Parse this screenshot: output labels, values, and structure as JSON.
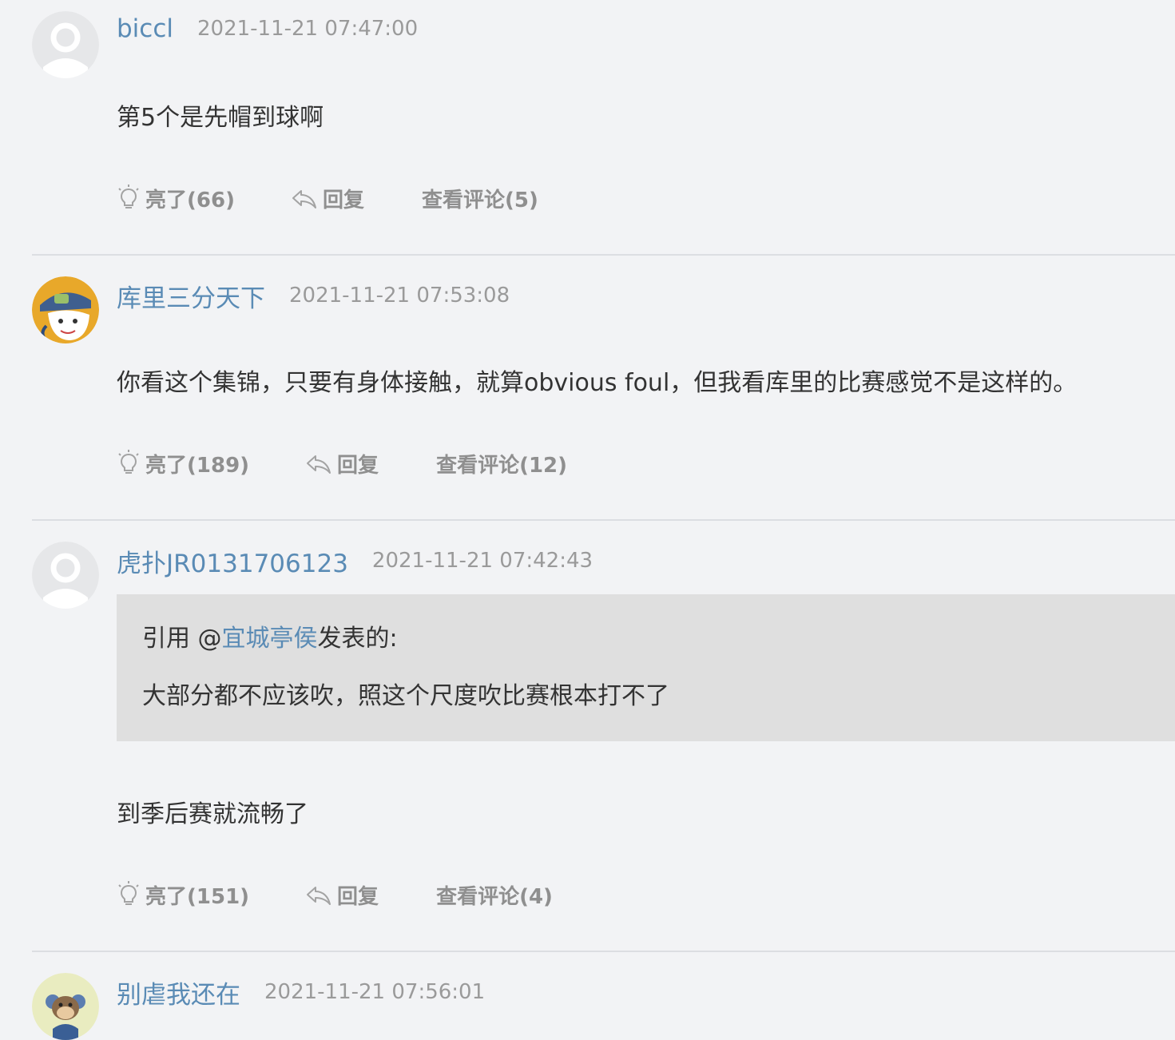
{
  "comments": [
    {
      "username": "biccl",
      "timestamp": "2021-11-21 07:47:00",
      "text": "第5个是先帽到球啊",
      "avatar_icon": "default-user-avatar",
      "actions": {
        "like": "亮了(66)",
        "reply": "回复",
        "view": "查看评论(5)"
      }
    },
    {
      "username": "库里三分天下",
      "timestamp": "2021-11-21 07:53:08",
      "text": "你看这个集锦，只要有身体接触，就算obvious foul，但我看库里的比赛感觉不是这样的。",
      "avatar_icon": "cartoon-character-avatar",
      "actions": {
        "like": "亮了(189)",
        "reply": "回复",
        "view": "查看评论(12)"
      }
    },
    {
      "username": "虎扑JR0131706123",
      "timestamp": "2021-11-21 07:42:43",
      "avatar_icon": "default-user-avatar",
      "quote": {
        "prefix": "引用 @",
        "user": "宜城亭侯",
        "suffix": "发表的:",
        "text": "大部分都不应该吹，照这个尺度吹比赛根本打不了"
      },
      "text": "到季后赛就流畅了",
      "actions": {
        "like": "亮了(151)",
        "reply": "回复",
        "view": "查看评论(4)"
      }
    },
    {
      "username": "别虐我还在",
      "timestamp": "2021-11-21 07:56:01",
      "avatar_icon": "cartoon-monkey-avatar"
    }
  ],
  "colors": {
    "background": "#f2f3f5",
    "username": "#5a8bb5",
    "timestamp": "#9a9a9a",
    "action": "#8f8f8f",
    "quote_bg": "#dfdfdf"
  }
}
